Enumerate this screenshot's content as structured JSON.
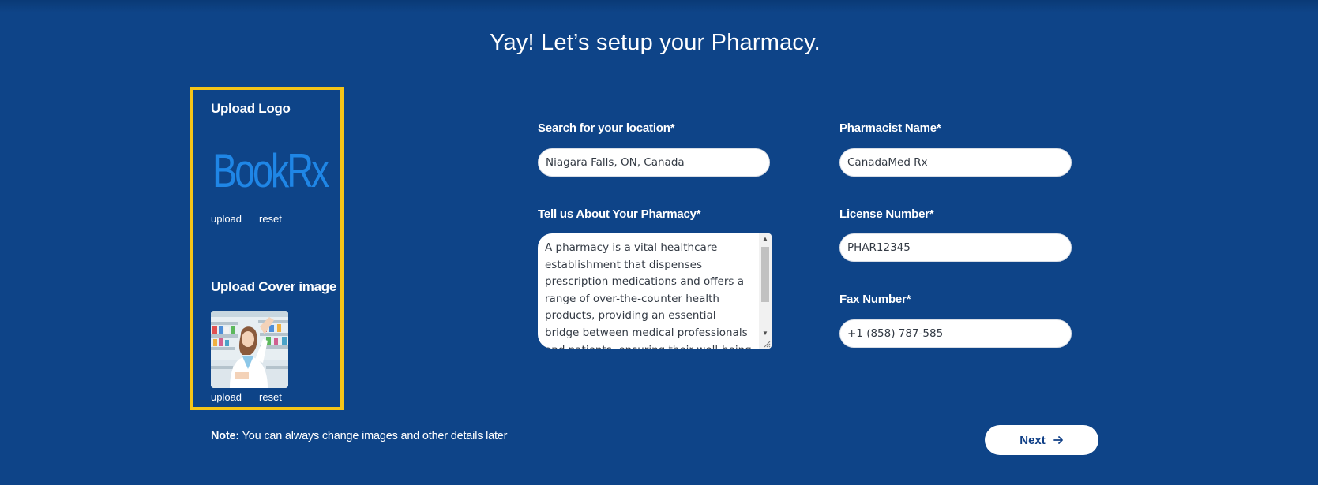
{
  "page": {
    "title": "Yay! Let’s setup your Pharmacy."
  },
  "upload": {
    "logo_heading": "Upload Logo",
    "logo_text": "BookRx",
    "cover_heading": "Upload Cover image",
    "upload_label": "upload",
    "reset_label": "reset"
  },
  "form": {
    "location_label": "Search for your location*",
    "location_value": "Niagara Falls, ON, Canada",
    "about_label": "Tell us About Your Pharmacy*",
    "about_value": "A pharmacy is a vital healthcare establishment that dispenses prescription medications and offers a range of over-the-counter health products, providing an essential bridge between medical professionals and patients, ensuring their well-being and",
    "pharmacist_label": "Pharmacist Name*",
    "pharmacist_value": "CanadaMed Rx",
    "license_label": "License Number*",
    "license_value": "PHAR12345",
    "fax_label": "Fax Number*",
    "fax_value": "+1 (858) 787-585"
  },
  "note": {
    "prefix": "Note:",
    "text": " You can always change images and other details later"
  },
  "actions": {
    "next_label": "Next"
  },
  "colors": {
    "background": "#0e4488",
    "panel_border": "#f5c518",
    "button_text": "#0e3e86"
  },
  "icons": {
    "next": "arrow-right-icon",
    "scroll_up": "triangle-up-icon",
    "scroll_down": "triangle-down-icon"
  }
}
